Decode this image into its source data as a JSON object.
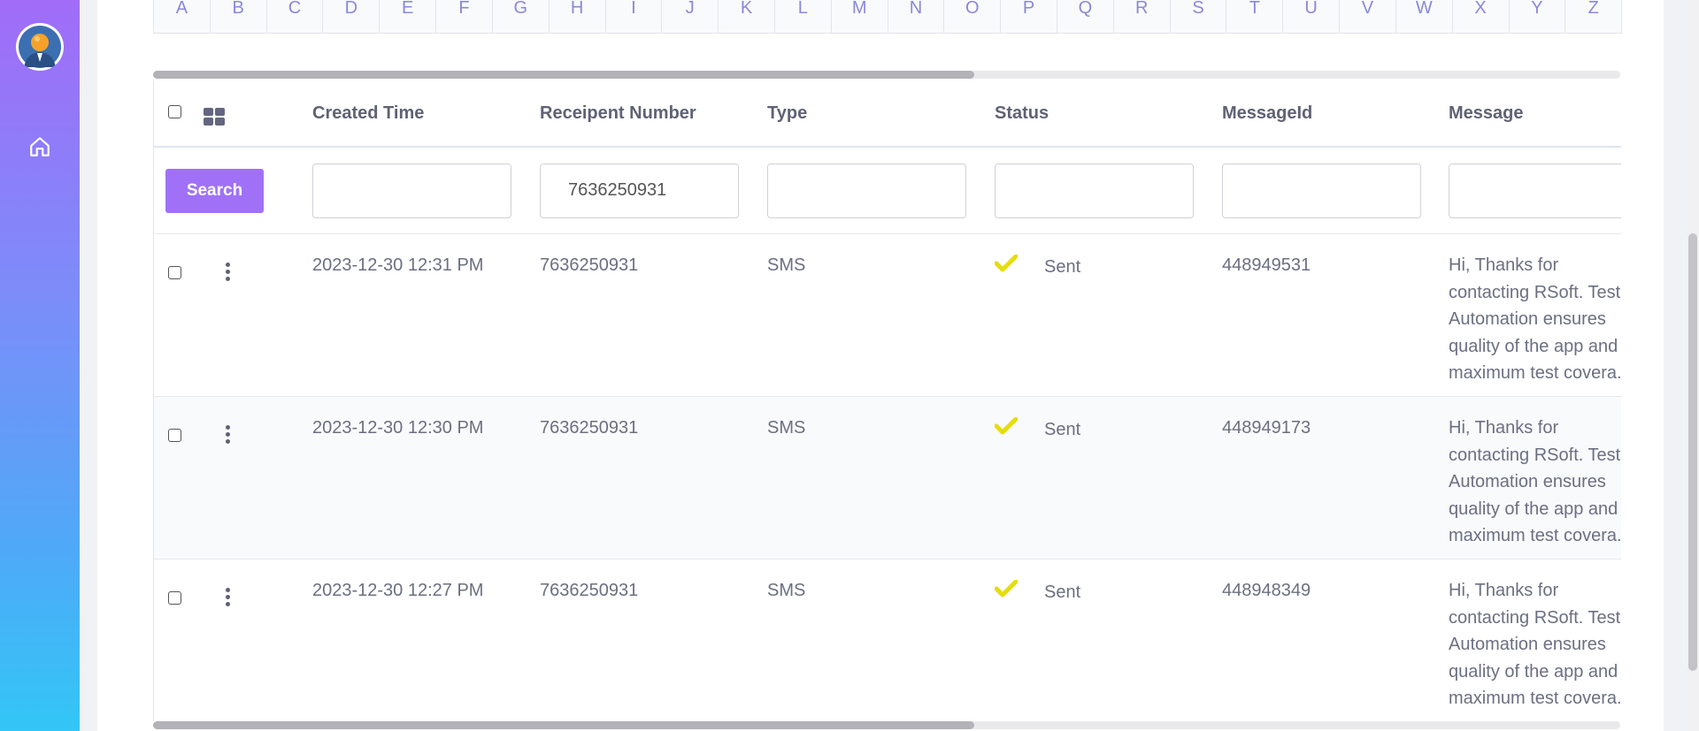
{
  "alphabet": [
    "A",
    "B",
    "C",
    "D",
    "E",
    "F",
    "G",
    "H",
    "I",
    "J",
    "K",
    "L",
    "M",
    "N",
    "O",
    "P",
    "Q",
    "R",
    "S",
    "T",
    "U",
    "V",
    "W",
    "X",
    "Y",
    "Z"
  ],
  "columns": {
    "created_time": "Created Time",
    "recipient_number": "Receipent Number",
    "type": "Type",
    "status": "Status",
    "message_id": "MessageId",
    "message": "Message"
  },
  "filters": {
    "search_label": "Search",
    "created_time": "",
    "recipient_number": "7636250931",
    "type": "",
    "status": "",
    "message_id": "",
    "message": ""
  },
  "rows": [
    {
      "created_time": "2023-12-30 12:31 PM",
      "recipient_number": "7636250931",
      "type": "SMS",
      "status": "Sent",
      "message_id": "448949531",
      "message": "Hi, Thanks for contacting RSoft. Test Automation ensures quality of the app and maximum test covera..."
    },
    {
      "created_time": "2023-12-30 12:30 PM",
      "recipient_number": "7636250931",
      "type": "SMS",
      "status": "Sent",
      "message_id": "448949173",
      "message": "Hi, Thanks for contacting RSoft. Test Automation ensures quality of the app and maximum test covera..."
    },
    {
      "created_time": "2023-12-30 12:27 PM",
      "recipient_number": "7636250931",
      "type": "SMS",
      "status": "Sent",
      "message_id": "448948349",
      "message": "Hi, Thanks for contacting RSoft. Test Automation ensures quality of the app and maximum test covera..."
    }
  ],
  "icons": {
    "sidebar": [
      "user-avatar-icon",
      "home-icon"
    ],
    "row_actions": "kebab-menu-icon",
    "status_sent": "check-icon",
    "column_toggle": "grid-icon"
  },
  "colors": {
    "accent": "#a071f6",
    "sidebar_top": "#a16cf8",
    "sidebar_bottom": "#33c6f6",
    "status_check": "#e6dd0c",
    "alphabet_link": "#8a88d8"
  }
}
